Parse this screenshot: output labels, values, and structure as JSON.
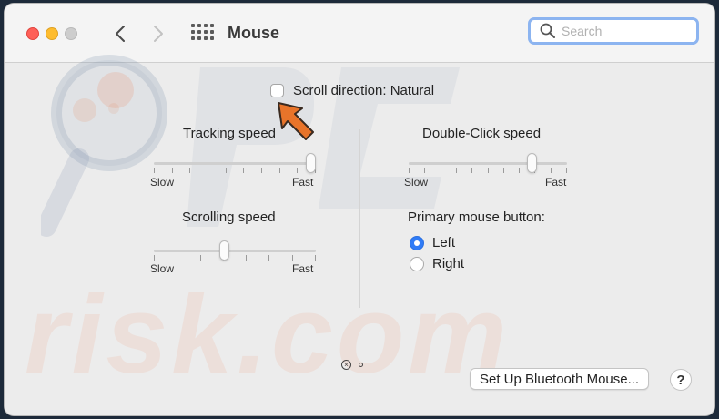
{
  "window": {
    "title": "Mouse"
  },
  "search": {
    "placeholder": "Search",
    "value": ""
  },
  "scroll_direction": {
    "label": "Scroll direction: Natural",
    "checked": false
  },
  "tracking": {
    "label": "Tracking speed",
    "min_label": "Slow",
    "max_label": "Fast",
    "value": 1.0
  },
  "double_click": {
    "label": "Double-Click speed",
    "min_label": "Slow",
    "max_label": "Fast",
    "value": 0.8
  },
  "scrolling": {
    "label": "Scrolling speed",
    "min_label": "Slow",
    "max_label": "Fast",
    "value": 0.43
  },
  "primary_button": {
    "label": "Primary mouse button:",
    "options": [
      {
        "label": "Left",
        "selected": true
      },
      {
        "label": "Right",
        "selected": false
      }
    ]
  },
  "bluetooth_button": {
    "label": "Set Up Bluetooth Mouse..."
  },
  "help_button": {
    "label": "?"
  },
  "pager": {
    "page": 1,
    "total": 2
  },
  "watermark": {
    "text": "risk.com"
  },
  "icons": {
    "back": "chevron-left-icon",
    "forward": "chevron-right-icon",
    "grid": "grid-icon",
    "search": "magnifier-icon",
    "annotation_arrow": "orange-arrow-icon"
  },
  "colors": {
    "accent": "#2f7bf6",
    "search_focus": "#8cb4f0",
    "annotation": "#e8742a"
  }
}
